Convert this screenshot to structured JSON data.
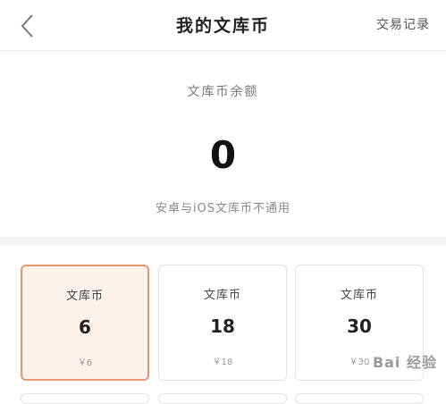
{
  "header": {
    "title": "我的文库币",
    "records_link": "交易记录",
    "back_icon": "chevron-left-icon"
  },
  "balance": {
    "label": "文库币余额",
    "value": "0",
    "note": "安卓与iOS文库币不通用"
  },
  "packages": [
    {
      "label": "文库币",
      "amount": "6",
      "price": "￥6",
      "selected": true
    },
    {
      "label": "文库币",
      "amount": "18",
      "price": "￥18",
      "selected": false
    },
    {
      "label": "文库币",
      "amount": "30",
      "price": "￥30",
      "selected": false
    }
  ],
  "watermark": {
    "text": "Bai 经验"
  },
  "colors": {
    "selected_border": "#e4966f",
    "selected_bg": "#fdf1ec"
  }
}
